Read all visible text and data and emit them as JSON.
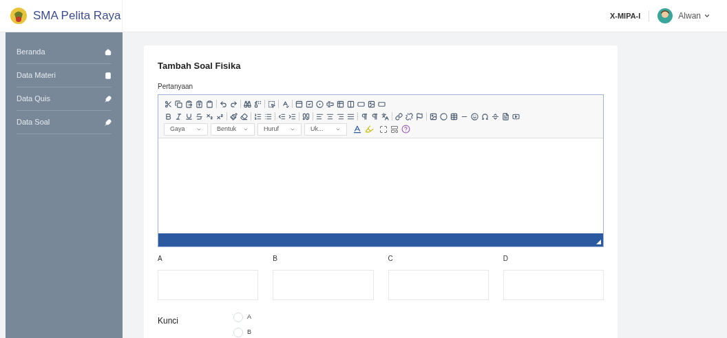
{
  "brand": {
    "name": "SMA Pelita Raya"
  },
  "header": {
    "class_name": "X-MIPA-I",
    "user": "Alwan"
  },
  "sidebar": {
    "items": [
      {
        "label": "Beranda",
        "selected": false
      },
      {
        "label": "Data Materi",
        "selected": false
      },
      {
        "label": "Data Quis",
        "selected": false
      },
      {
        "label": "Data Soal",
        "selected": false
      }
    ]
  },
  "form": {
    "title": "Tambah Soal Fisika",
    "question_label": "Pertanyaan",
    "editor": {
      "dropdowns": [
        "Gaya",
        "Bentuk",
        "Huruf",
        "Uk..."
      ]
    },
    "options": [
      {
        "label": "A"
      },
      {
        "label": "B"
      },
      {
        "label": "C"
      },
      {
        "label": "D"
      }
    ],
    "key_label": "Kunci",
    "key_choices": [
      {
        "label": "A",
        "selected": false
      },
      {
        "label": "B",
        "selected": false
      }
    ]
  }
}
